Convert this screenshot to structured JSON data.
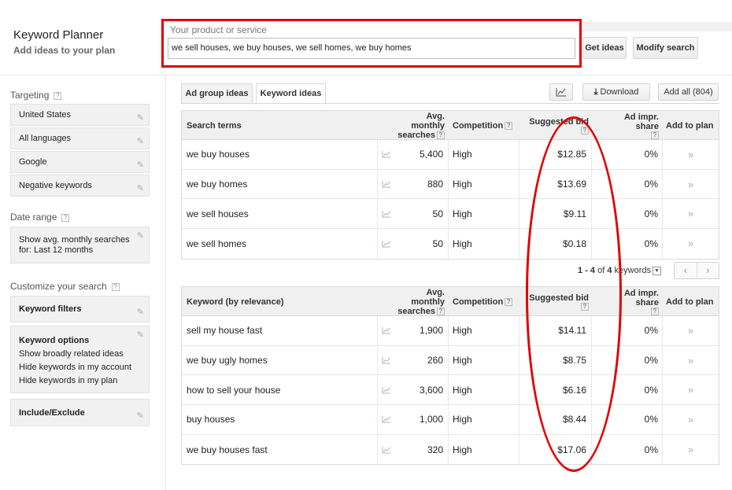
{
  "header": {
    "title": "Keyword Planner",
    "subtitle": "Add ideas to your plan",
    "product_label": "Your product or service",
    "product_value": "we sell houses, we buy houses, we sell homes, we buy homes",
    "get_ideas_label": "Get ideas",
    "modify_search_label": "Modify search"
  },
  "sidebar": {
    "targeting_heading": "Targeting",
    "targeting_items": [
      "United States",
      "All languages",
      "Google",
      "Negative keywords"
    ],
    "date_range_heading": "Date range",
    "date_range_line1": "Show avg. monthly searches",
    "date_range_line2": "for: Last 12 months",
    "customize_heading": "Customize your search",
    "keyword_filters_label": "Keyword filters",
    "keyword_options_label": "Keyword options",
    "keyword_options_lines": [
      "Show broadly related ideas",
      "Hide keywords in my account",
      "Hide keywords in my plan"
    ],
    "include_exclude_label": "Include/Exclude",
    "help_mark": "?"
  },
  "tabs": {
    "ad_group_ideas": "Ad group ideas",
    "keyword_ideas": "Keyword ideas"
  },
  "toolbar": {
    "download_label": "Download",
    "add_all_label": "Add all (804)"
  },
  "columns": {
    "avg_monthly_line1": "Avg. monthly",
    "avg_monthly_line2": "searches",
    "competition": "Competition",
    "suggested_bid": "Suggested bid",
    "ad_impr_share": "Ad impr. share",
    "add_to_plan": "Add to plan"
  },
  "search_terms_table": {
    "first_column": "Search terms",
    "rows": [
      {
        "term": "we buy houses",
        "avg": "5,400",
        "competition": "High",
        "bid": "$12.85",
        "share": "0%"
      },
      {
        "term": "we buy homes",
        "avg": "880",
        "competition": "High",
        "bid": "$13.69",
        "share": "0%"
      },
      {
        "term": "we sell houses",
        "avg": "50",
        "competition": "High",
        "bid": "$9.11",
        "share": "0%"
      },
      {
        "term": "we sell homes",
        "avg": "50",
        "competition": "High",
        "bid": "$0.18",
        "share": "0%"
      }
    ]
  },
  "pager": {
    "range": "1 - 4",
    "of": "of",
    "total": "4",
    "unit": "keywords"
  },
  "keyword_table": {
    "first_column": "Keyword (by relevance)",
    "rows": [
      {
        "term": "sell my house fast",
        "avg": "1,900",
        "competition": "High",
        "bid": "$14.11",
        "share": "0%"
      },
      {
        "term": "we buy ugly homes",
        "avg": "260",
        "competition": "High",
        "bid": "$8.75",
        "share": "0%"
      },
      {
        "term": "how to sell your house",
        "avg": "3,600",
        "competition": "High",
        "bid": "$6.16",
        "share": "0%"
      },
      {
        "term": "buy houses",
        "avg": "1,000",
        "competition": "High",
        "bid": "$8.44",
        "share": "0%"
      },
      {
        "term": "we buy houses fast",
        "avg": "320",
        "competition": "High",
        "bid": "$17.06",
        "share": "0%"
      }
    ]
  }
}
